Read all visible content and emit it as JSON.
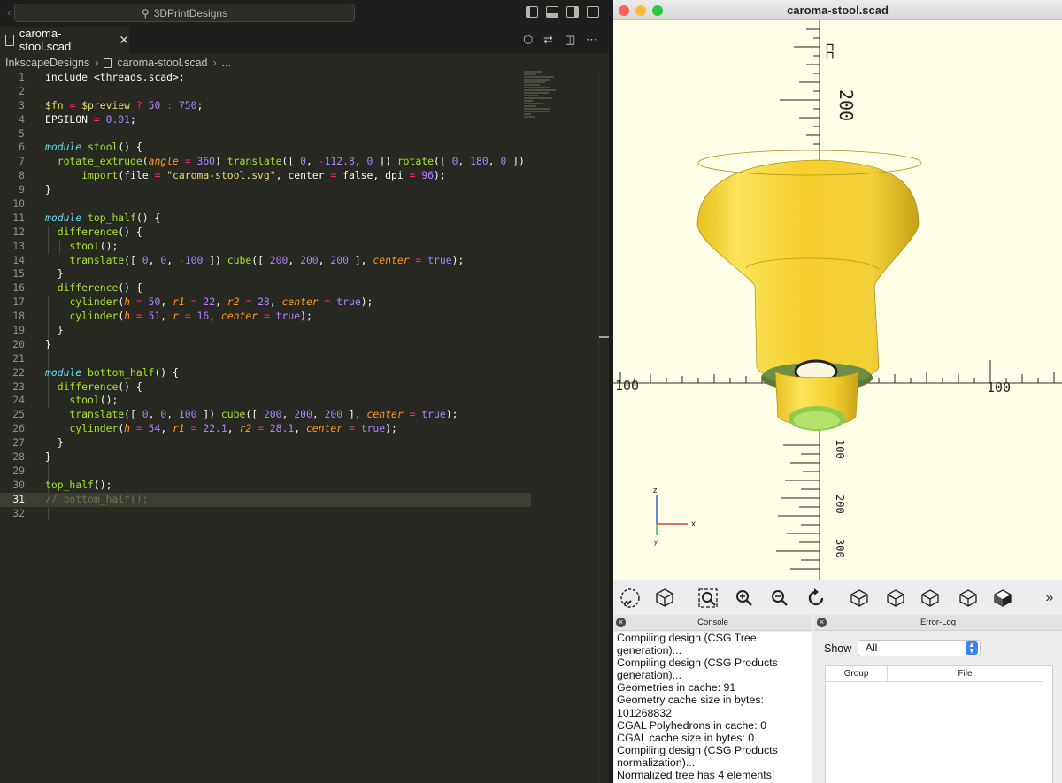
{
  "vscode": {
    "search_text": "3DPrintDesigns",
    "tab_label": "caroma-stool.scad",
    "breadcrumb": {
      "folder": "InkscapeDesigns",
      "file": "caroma-stool.scad",
      "more": "..."
    },
    "current_line": 31,
    "lines": [
      {
        "num": "1"
      },
      {
        "num": "2"
      },
      {
        "num": "3"
      },
      {
        "num": "4"
      },
      {
        "num": "5"
      },
      {
        "num": "6"
      },
      {
        "num": "7"
      },
      {
        "num": "8"
      },
      {
        "num": "9"
      },
      {
        "num": "10"
      },
      {
        "num": "11"
      },
      {
        "num": "12"
      },
      {
        "num": "13"
      },
      {
        "num": "14"
      },
      {
        "num": "15"
      },
      {
        "num": "16"
      },
      {
        "num": "17"
      },
      {
        "num": "18"
      },
      {
        "num": "19"
      },
      {
        "num": "20"
      },
      {
        "num": "21"
      },
      {
        "num": "22"
      },
      {
        "num": "23"
      },
      {
        "num": "24"
      },
      {
        "num": "25"
      },
      {
        "num": "26"
      },
      {
        "num": "27"
      },
      {
        "num": "28"
      },
      {
        "num": "29"
      },
      {
        "num": "30"
      },
      {
        "num": "31"
      },
      {
        "num": "32"
      }
    ]
  },
  "openscad": {
    "window_title": "caroma-stool.scad",
    "axis_labels": {
      "x": "x",
      "y": "y",
      "z": "z"
    },
    "ruler_labels": {
      "top_200": "200",
      "mid_300": "300",
      "mid_100": "100",
      "left_100": "100",
      "right_100": "100",
      "low_1": "100",
      "low_2": "200",
      "low_3": "300"
    },
    "console": {
      "title": "Console",
      "lines": [
        "Compiling design (CSG Tree generation)...",
        "Compiling design (CSG Products generation)...",
        "Geometries in cache: 91",
        "Geometry cache size in bytes: 101268832",
        "CGAL Polyhedrons in cache: 0",
        "CGAL cache size in bytes: 0",
        "Compiling design (CSG Products normalization)...",
        "Normalized tree has 4 elements!"
      ]
    },
    "error_log": {
      "title": "Error-Log",
      "show_label": "Show",
      "show_value": "All",
      "columns": [
        "Group",
        "File"
      ]
    }
  },
  "colors": {
    "editor_bg": "#272822",
    "viewport_bg": "#fffee6",
    "model_yellow": "#f9d72c",
    "model_green": "#9dd35c"
  }
}
